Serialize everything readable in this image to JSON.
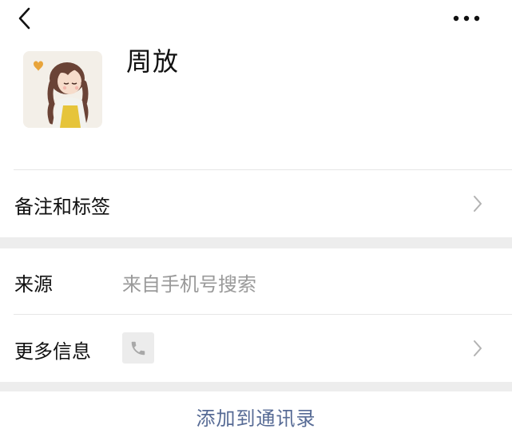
{
  "profile": {
    "name": "周放"
  },
  "rows": {
    "remark": {
      "label": "备注和标签"
    },
    "source": {
      "label": "来源",
      "value": "来自手机号搜索"
    },
    "more_info": {
      "label": "更多信息"
    }
  },
  "actions": {
    "add_to_contacts": "添加到通讯录"
  },
  "colors": {
    "link": "#576b95",
    "separator": "#ededed",
    "muted_text": "#9a9a9a"
  },
  "icons": [
    "back-arrow-icon",
    "more-dots-icon",
    "chevron-right-icon",
    "phone-icon"
  ]
}
